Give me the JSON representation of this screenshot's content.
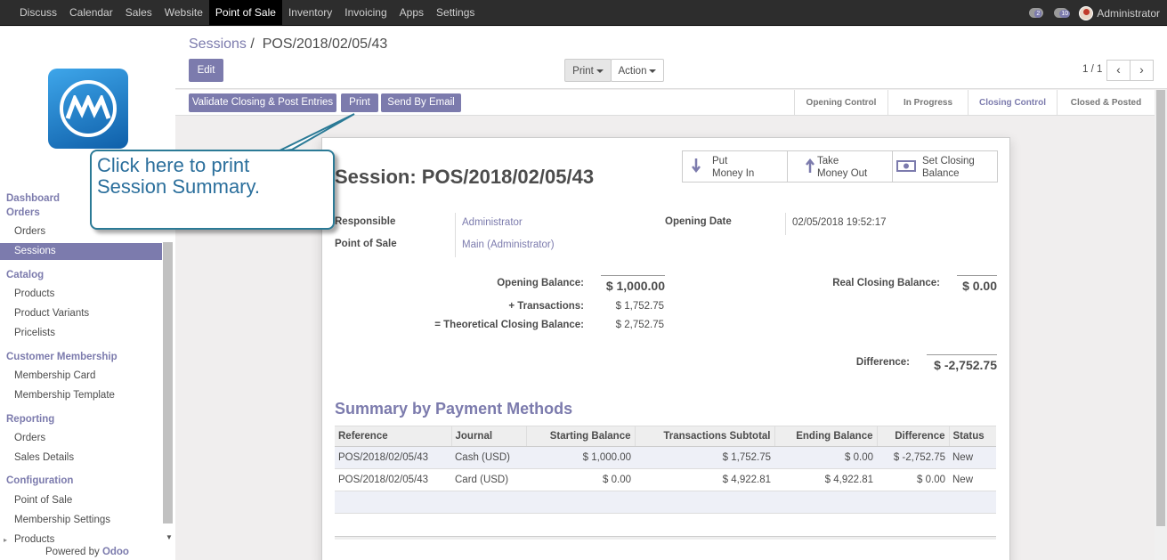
{
  "topbar": {
    "menu": [
      "Discuss",
      "Calendar",
      "Sales",
      "Website",
      "Point of Sale",
      "Inventory",
      "Invoicing",
      "Apps",
      "Settings"
    ],
    "active": "Point of Sale",
    "chat_count": "2",
    "activity_count": "10",
    "user": "Administrator"
  },
  "sidebar": {
    "dashboard": "Dashboard",
    "orders_section": "Orders",
    "orders_items": [
      "Orders",
      "Sessions"
    ],
    "catalog_section": "Catalog",
    "catalog_items": [
      "Products",
      "Product Variants",
      "Pricelists"
    ],
    "membership_section": "Customer Membership",
    "membership_items": [
      "Membership Card",
      "Membership Template"
    ],
    "reporting_section": "Reporting",
    "reporting_items": [
      "Orders",
      "Sales Details"
    ],
    "config_section": "Configuration",
    "config_items": [
      "Point of Sale",
      "Membership Settings",
      "Products"
    ],
    "powered_prefix": "Powered by",
    "powered_brand": "Odoo"
  },
  "control": {
    "breadcrumb_parent": "Sessions",
    "breadcrumb_sep": "/",
    "breadcrumb_current": "POS/2018/02/05/43",
    "edit": "Edit",
    "print": "Print",
    "action": "Action",
    "pager": "1 / 1"
  },
  "statusbar": {
    "validate": "Validate Closing & Post Entries",
    "print": "Print",
    "send": "Send By Email",
    "stages": [
      "Opening Control",
      "In Progress",
      "Closing Control",
      "Closed & Posted"
    ],
    "current_stage": "Closing Control"
  },
  "sheet": {
    "title": "Session: POS/2018/02/05/43",
    "buttons": {
      "put_1": "Put",
      "put_2": "Money In",
      "take_1": "Take",
      "take_2": "Money Out",
      "set_1": "Set Closing",
      "set_2": "Balance"
    },
    "responsible_label": "Responsible",
    "responsible": "Administrator",
    "pos_label": "Point of Sale",
    "pos": "Main (Administrator)",
    "opening_date_label": "Opening Date",
    "opening_date": "02/05/2018 19:52:17",
    "opening_balance_label": "Opening Balance:",
    "opening_balance": "$ 1,000.00",
    "transactions_label": "+ Transactions:",
    "transactions": "$ 1,752.75",
    "theoretical_label": "= Theoretical Closing Balance:",
    "theoretical": "$ 2,752.75",
    "real_closing_label": "Real Closing Balance:",
    "real_closing": "$ 0.00",
    "difference_label": "Difference:",
    "difference": "$ -2,752.75",
    "summary_title": "Summary by Payment Methods",
    "table": {
      "headers": [
        "Reference",
        "Journal",
        "Starting Balance",
        "Transactions Subtotal",
        "Ending Balance",
        "Difference",
        "Status"
      ],
      "rows": [
        [
          "POS/2018/02/05/43",
          "Cash (USD)",
          "$ 1,000.00",
          "$ 1,752.75",
          "$ 0.00",
          "$ -2,752.75",
          "New"
        ],
        [
          "POS/2018/02/05/43",
          "Card (USD)",
          "$ 0.00",
          "$ 4,922.81",
          "$ 4,922.81",
          "$ 0.00",
          "New"
        ]
      ]
    }
  },
  "callout": {
    "line1": "Click here to print",
    "line2": "Session Summary."
  },
  "colors": {
    "accent": "#7c7bad",
    "topbar": "#2d2d2d",
    "callout_border": "#2b7a96",
    "callout_text": "#2b6f9c"
  }
}
